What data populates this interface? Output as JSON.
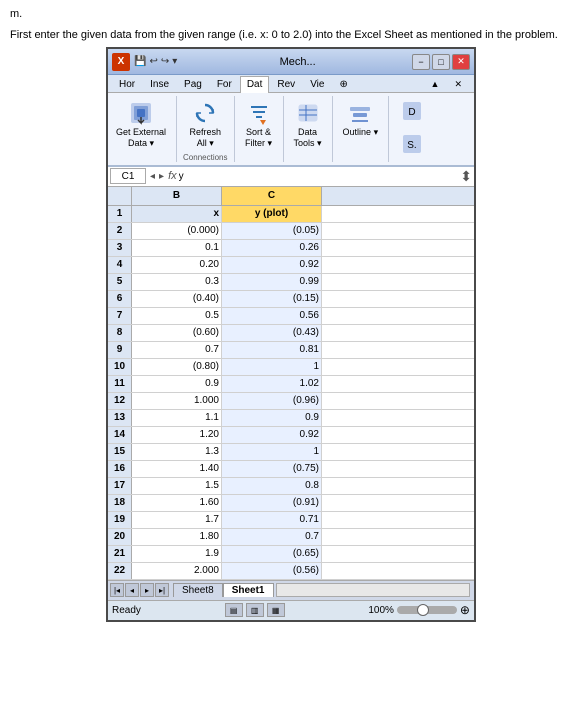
{
  "page": {
    "intro_line1": "m.",
    "intro_line2": "First enter the given data from the given range (i.e. x: 0 to 2.0) into the Excel Sheet as mentioned in the problem."
  },
  "titlebar": {
    "title": "Mech...",
    "icon_text": "X",
    "minimize": "−",
    "maximize": "□",
    "close": "✕"
  },
  "ribbon": {
    "tabs": [
      "Hor",
      "Inse",
      "Pag",
      "For",
      "Dat",
      "Rev",
      "Vie",
      "⊕"
    ],
    "active_tab": "Dat",
    "groups": {
      "external": {
        "label": "Get External\nData",
        "icon": "📥"
      },
      "refresh": {
        "label": "Refresh\nAll",
        "icon": "🔄"
      },
      "connections_label": "Connections",
      "sort_filter": {
        "label": "Sort &\nFilter",
        "icon": "⇅"
      },
      "data_tools": {
        "label": "Data\nTools",
        "icon": "🗂"
      },
      "outline": {
        "label": "Outline",
        "icon": "📊"
      },
      "extra1": "D",
      "extra2": "S."
    }
  },
  "formula_bar": {
    "name_box": "C1",
    "fx": "fx",
    "value": "y"
  },
  "columns": {
    "row_num_header": "",
    "b_header": "B",
    "c_header": "C",
    "b_width": 90,
    "c_width": 100
  },
  "rows": [
    {
      "num": "1",
      "b": "x",
      "c": "y (plot)",
      "is_header": true
    },
    {
      "num": "2",
      "b": "(0.000)",
      "c": "(0.05)"
    },
    {
      "num": "3",
      "b": "0.1",
      "c": "0.26"
    },
    {
      "num": "4",
      "b": "0.20",
      "c": "0.92"
    },
    {
      "num": "5",
      "b": "0.3",
      "c": "0.99"
    },
    {
      "num": "6",
      "b": "(0.40)",
      "c": "(0.15)"
    },
    {
      "num": "7",
      "b": "0.5",
      "c": "0.56"
    },
    {
      "num": "8",
      "b": "(0.60)",
      "c": "(0.43)"
    },
    {
      "num": "9",
      "b": "0.7",
      "c": "0.81"
    },
    {
      "num": "10",
      "b": "(0.80)",
      "c": "1"
    },
    {
      "num": "11",
      "b": "0.9",
      "c": "1.02"
    },
    {
      "num": "12",
      "b": "1.000",
      "c": "(0.96)"
    },
    {
      "num": "13",
      "b": "1.1",
      "c": "0.9"
    },
    {
      "num": "14",
      "b": "1.20",
      "c": "0.92"
    },
    {
      "num": "15",
      "b": "1.3",
      "c": "1"
    },
    {
      "num": "16",
      "b": "1.40",
      "c": "(0.75)"
    },
    {
      "num": "17",
      "b": "1.5",
      "c": "0.8"
    },
    {
      "num": "18",
      "b": "1.60",
      "c": "(0.91)"
    },
    {
      "num": "19",
      "b": "1.7",
      "c": "0.71"
    },
    {
      "num": "20",
      "b": "1.80",
      "c": "0.7"
    },
    {
      "num": "21",
      "b": "1.9",
      "c": "(0.65)"
    },
    {
      "num": "22",
      "b": "2.000",
      "c": "(0.56)"
    }
  ],
  "sheet_tabs": [
    "Sheet8",
    "Sheet1"
  ],
  "active_sheet": "Sheet1",
  "status": {
    "ready": "Ready",
    "zoom": "100%"
  }
}
